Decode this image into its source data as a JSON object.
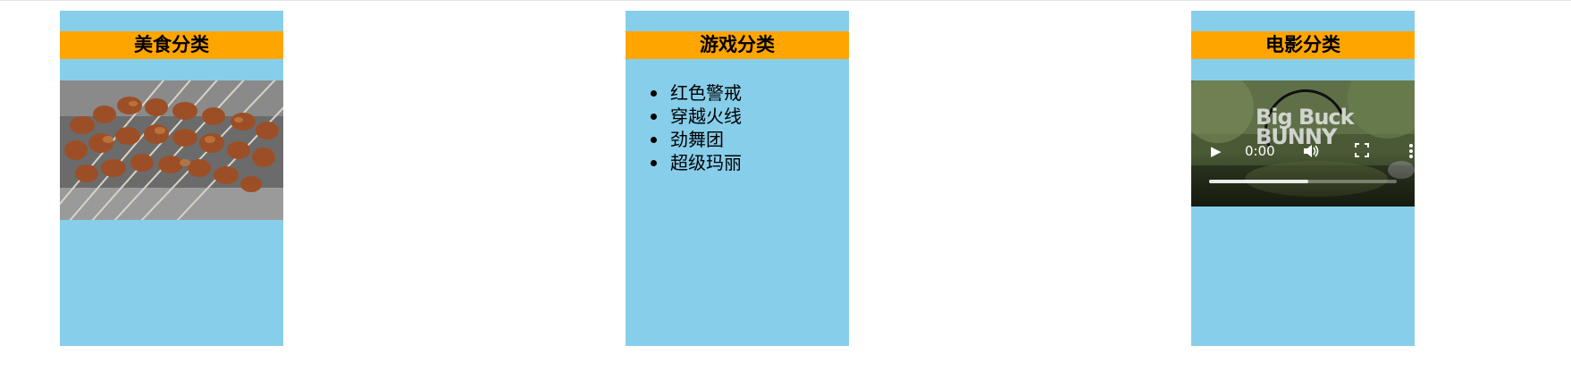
{
  "panels": [
    {
      "title": "美食分类",
      "content": "image"
    },
    {
      "title": "游戏分类",
      "items": [
        "红色警戒",
        "穿越火线",
        "劲舞团",
        "超级玛丽"
      ]
    },
    {
      "title": "电影分类",
      "content": "video"
    }
  ],
  "video": {
    "time": "0:00",
    "title_art": [
      "Big Buck",
      "BUNNY"
    ],
    "progress": 0.53,
    "icons": [
      "play-icon",
      "volume-icon",
      "fullscreen-icon",
      "more-options-icon"
    ]
  },
  "colors": {
    "panel_bg": "#87ceeb",
    "title_bg": "#ffa500"
  }
}
